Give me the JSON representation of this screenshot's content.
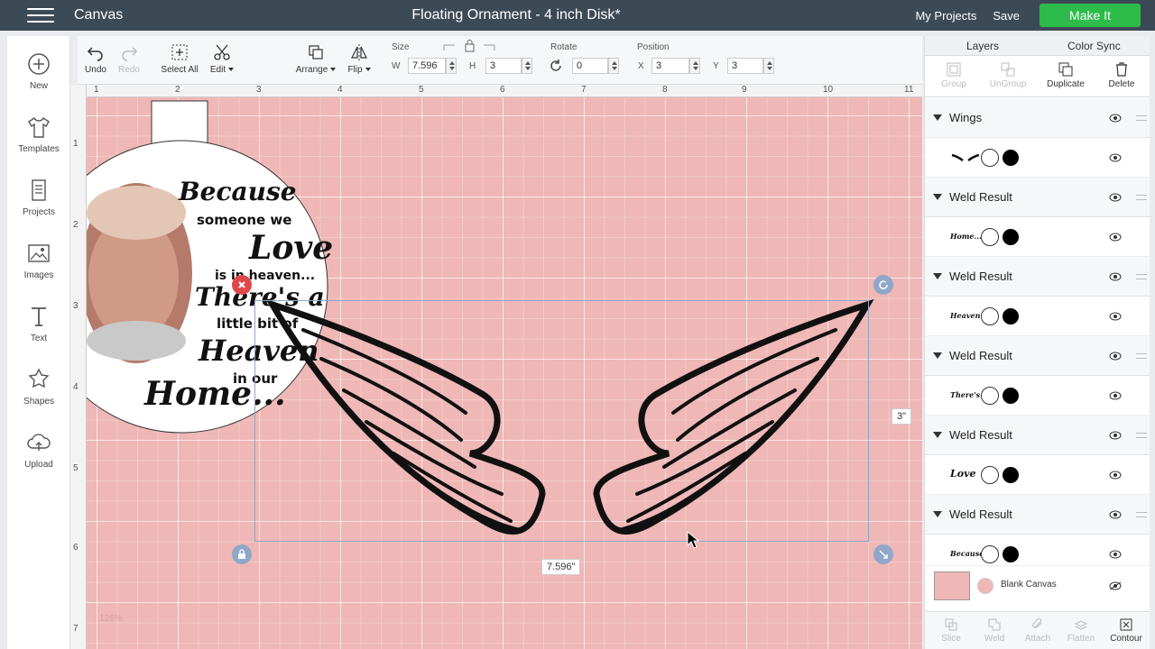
{
  "header": {
    "app_title": "Canvas",
    "doc_title": "Floating Ornament - 4 inch Disk*",
    "my_projects": "My Projects",
    "save": "Save",
    "make_it": "Make It"
  },
  "left_rail": [
    {
      "label": "New",
      "icon": "plus-circle-icon"
    },
    {
      "label": "Templates",
      "icon": "tshirt-icon"
    },
    {
      "label": "Projects",
      "icon": "projects-icon"
    },
    {
      "label": "Images",
      "icon": "image-icon"
    },
    {
      "label": "Text",
      "icon": "text-icon"
    },
    {
      "label": "Shapes",
      "icon": "shapes-icon"
    },
    {
      "label": "Upload",
      "icon": "upload-cloud-icon"
    }
  ],
  "toolbar": {
    "undo": "Undo",
    "redo": "Redo",
    "select_all": "Select All",
    "edit": "Edit",
    "arrange": "Arrange",
    "flip": "Flip",
    "size_label": "Size",
    "w_label": "W",
    "w_value": "7.596",
    "h_label": "H",
    "h_value": "3",
    "rotate_label": "Rotate",
    "rotate_value": "0",
    "position_label": "Position",
    "x_label": "X",
    "x_value": "3",
    "y_label": "Y",
    "y_value": "3"
  },
  "rulers": {
    "top": [
      "1",
      "2",
      "3",
      "4",
      "5",
      "6",
      "7",
      "8",
      "9",
      "10",
      "11"
    ],
    "left": [
      "1",
      "2",
      "3",
      "4",
      "5",
      "6",
      "7"
    ]
  },
  "ornament": {
    "lines": [
      "Because",
      "someone we",
      "Love",
      "is in heaven...",
      "There's a",
      "little bit of",
      "Heaven",
      "in our",
      "Home..."
    ]
  },
  "canvas": {
    "width_label": "7.596\"",
    "height_label": "3\"",
    "zoom": "125%"
  },
  "right_panel": {
    "tabs": {
      "layers": "Layers",
      "color_sync": "Color Sync"
    },
    "tools": {
      "group": "Group",
      "ungroup": "UnGroup",
      "duplicate": "Duplicate",
      "delete": "Delete"
    },
    "layers": [
      {
        "name": "Wings",
        "thumb": "wings"
      },
      {
        "name": "Weld Result",
        "thumb": "Home..."
      },
      {
        "name": "Weld Result",
        "thumb": "Heaven"
      },
      {
        "name": "Weld Result",
        "thumb": "There's a"
      },
      {
        "name": "Weld Result",
        "thumb": "Love"
      },
      {
        "name": "Weld Result",
        "thumb": "Because"
      }
    ],
    "blank_canvas": "Blank Canvas",
    "bottom_tools": {
      "slice": "Slice",
      "weld": "Weld",
      "attach": "Attach",
      "flatten": "Flatten",
      "contour": "Contour"
    }
  },
  "colors": {
    "topbar": "#3c4a56",
    "make_it": "#2dbb4a",
    "canvas": "#efb7b6"
  }
}
